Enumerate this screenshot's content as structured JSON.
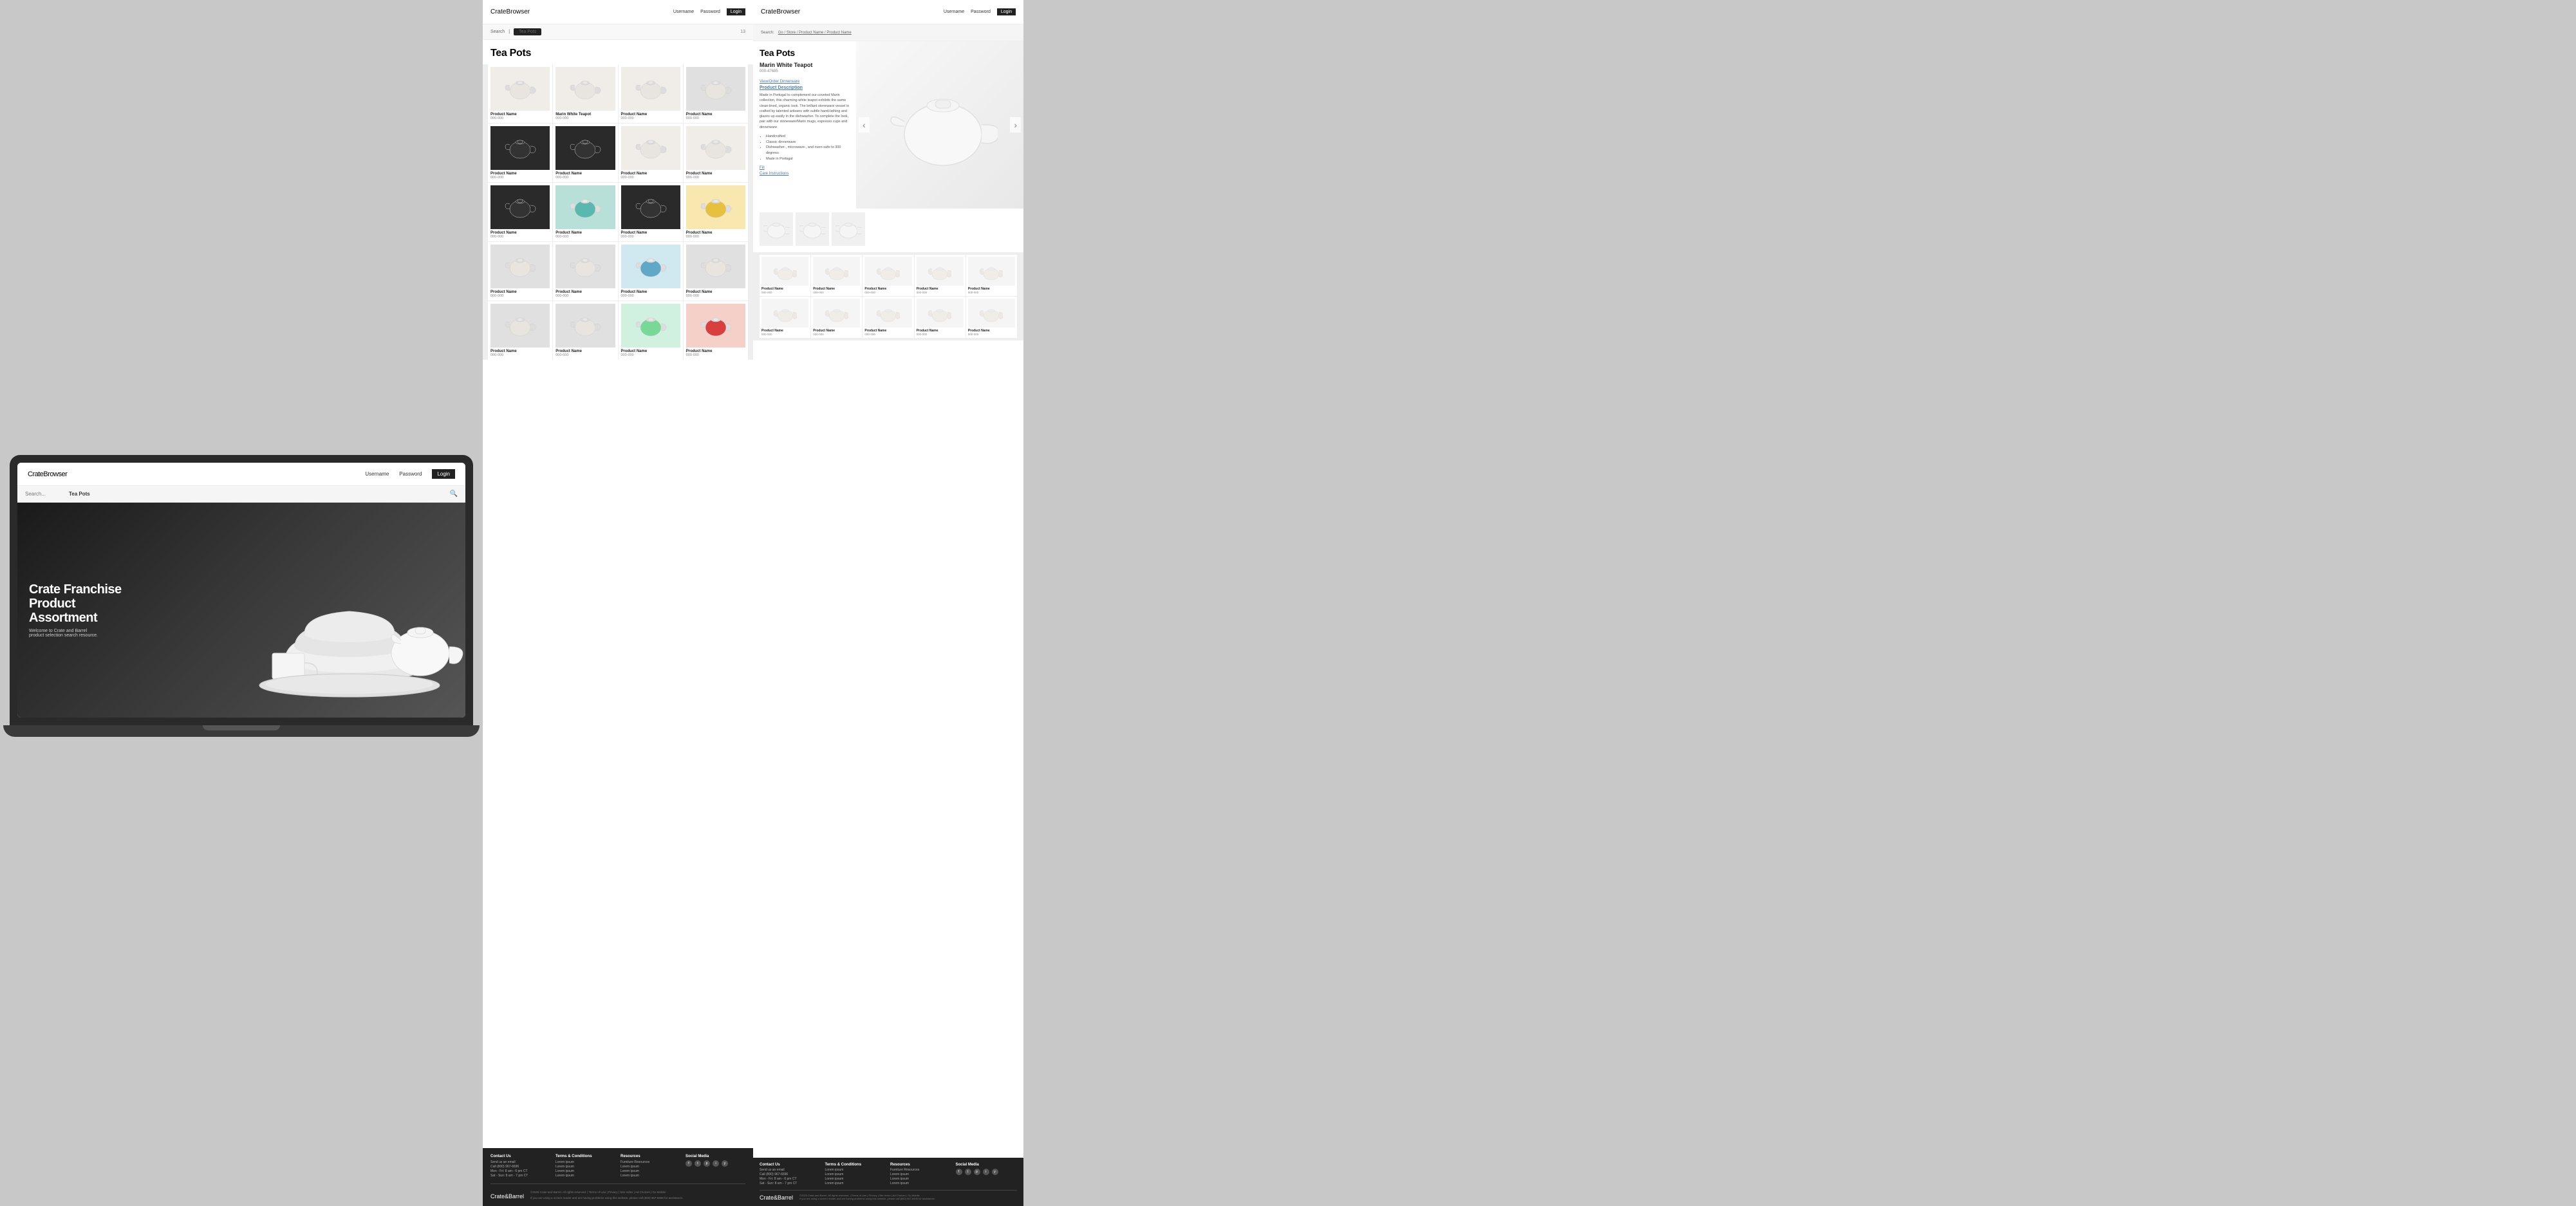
{
  "laptop": {
    "logo": "Crate",
    "logo_suffix": "Browser",
    "nav": {
      "username": "Username",
      "password": "Password",
      "login": "Login"
    },
    "search": {
      "placeholder": "Search...",
      "term": "Tea Pots"
    },
    "hero": {
      "headline_line1": "Crate Franchise",
      "headline_line2": "Product",
      "headline_line3": "Assortment",
      "subtext_line1": "Welcome to Crate and Barrel",
      "subtext_line2": "product selection search resource."
    }
  },
  "product_grid": {
    "logo": "Crate",
    "logo_suffix": "Browser",
    "nav": {
      "username": "Username",
      "password": "Password",
      "login": "Login"
    },
    "breadcrumb": {
      "search": "Search",
      "tab": "Tea Pots",
      "count": "13"
    },
    "title": "Tea Pots",
    "products": [
      {
        "name": "Product Name",
        "sku": "000-000",
        "style": "kettle-white"
      },
      {
        "name": "Marin White Teapot",
        "sku": "000-000",
        "style": "kettle-white"
      },
      {
        "name": "Product Name",
        "sku": "000-000",
        "style": "kettle-white"
      },
      {
        "name": "Product Name",
        "sku": "000-000",
        "style": "kettle-silver"
      },
      {
        "name": "Product Name",
        "sku": "000-000",
        "style": "kettle-black"
      },
      {
        "name": "Product Name",
        "sku": "000-000",
        "style": "kettle-black"
      },
      {
        "name": "Product Name",
        "sku": "000-000",
        "style": "kettle-white"
      },
      {
        "name": "Product Name",
        "sku": "000-000",
        "style": "kettle-white"
      },
      {
        "name": "Product Name",
        "sku": "000-000",
        "style": "kettle-black"
      },
      {
        "name": "Product Name",
        "sku": "000-000",
        "style": "kettle-teal"
      },
      {
        "name": "Product Name",
        "sku": "000-000",
        "style": "kettle-black"
      },
      {
        "name": "Product Name",
        "sku": "000-000",
        "style": "kettle-yellow"
      },
      {
        "name": "Product Name",
        "sku": "000-000",
        "style": "kettle-silver"
      },
      {
        "name": "Product Name",
        "sku": "000-000",
        "style": "kettle-silver"
      },
      {
        "name": "Product Name",
        "sku": "000-000",
        "style": "kettle-blue"
      },
      {
        "name": "Product Name",
        "sku": "000-000",
        "style": "kettle-silver"
      },
      {
        "name": "Product Name",
        "sku": "000-000",
        "style": "kettle-silver"
      },
      {
        "name": "Product Name",
        "sku": "000-000",
        "style": "kettle-silver"
      },
      {
        "name": "Product Name",
        "sku": "000-000",
        "style": "kettle-mint"
      },
      {
        "name": "Product Name",
        "sku": "000-000",
        "style": "kettle-red"
      }
    ],
    "footer": {
      "contact": {
        "title": "Contact Us",
        "line1": "Send us an email",
        "line2": "Call (800) 967-6696",
        "line3": "Mon - Fri: 8 am - 6 pm CT",
        "line4": "Sat - Sun: 8 am - 7 pm CT"
      },
      "terms": {
        "title": "Terms & Conditions",
        "line1": "Lorem ipsum",
        "line2": "Lorem ipsum",
        "line3": "Lorem ipsum",
        "line4": "Lorem ipsum"
      },
      "resources": {
        "title": "Resources",
        "line1": "Furniture Resources",
        "line2": "Lorem ipsum",
        "line3": "Lorem ipsum",
        "line4": "Lorem ipsum"
      },
      "social": {
        "title": "Social Media"
      },
      "logo": "Crate",
      "logo_suffix": "&Barrel",
      "legal": "©2025 Crate and Barrel. All rights reserved. | Terms of Use | Privacy | Site Index | Ad Choices | Go Mobile",
      "accessibility": "If you are using a screen reader and are having problems using this website, please call (800) 967-6696 for assistance."
    }
  },
  "product_detail": {
    "logo": "Crate",
    "logo_suffix": "Browser",
    "nav": {
      "username": "Username",
      "password": "Password",
      "login": "Login"
    },
    "search_bar": {
      "prefix": "Search:",
      "path": "Go / Store / Product Name / Product Name"
    },
    "page_title": "Tea Pots",
    "product": {
      "name": "Marin White Teapot",
      "sku": "000-47685",
      "department": "View/Order Dinnerware"
    },
    "description_title": "Product Description",
    "description": "Made in Portugal to complement our coveted Marin collection, this charming white teapot exhibits the same clean-lined, organic look. The brillant stoneware vessel is crafted by talented artisans with subtle hand-lathing and glazes up easily in the dishwasher. To complete the look, pair with our stoneware/Marin mugs, espresso cups and dinnerware.",
    "bullets": [
      "Handcrafted",
      "Classic dinnerware",
      "Dishwasher-, microwave-, and oven-safe to 300 degrees",
      "Made in Portugal"
    ],
    "fill_label": "Fill",
    "care_label": "Care Instructions",
    "thumbnails": [
      {
        "style": "white-teapot"
      },
      {
        "style": "white-teapot"
      },
      {
        "style": "white-teapot"
      }
    ],
    "related_products": [
      {
        "name": "Product Name",
        "sku": "000-000",
        "style": "kettle-white"
      },
      {
        "name": "Product Name",
        "sku": "000-000",
        "style": "kettle-white"
      },
      {
        "name": "Product Name",
        "sku": "000-000",
        "style": "kettle-white"
      },
      {
        "name": "Product Name",
        "sku": "000-000",
        "style": "kettle-white"
      },
      {
        "name": "Product Name",
        "sku": "000-000",
        "style": "kettle-white"
      },
      {
        "name": "Product Name",
        "sku": "000-000",
        "style": "kettle-white"
      },
      {
        "name": "Product Name",
        "sku": "000-000",
        "style": "kettle-white"
      },
      {
        "name": "Product Name",
        "sku": "000-000",
        "style": "kettle-white"
      },
      {
        "name": "Product Name",
        "sku": "000-000",
        "style": "kettle-white"
      },
      {
        "name": "Product Name",
        "sku": "000-000",
        "style": "kettle-white"
      }
    ],
    "footer": {
      "contact": {
        "title": "Contact Us",
        "line1": "Send us an email",
        "line2": "Call (800) 967-6696",
        "line3": "Mon - Fri: 8 am - 6 pm CT",
        "line4": "Sat - Sun: 8 am - 7 pm CT"
      },
      "terms": {
        "title": "Terms & Conditions",
        "line1": "Lorem ipsum",
        "line2": "Lorem ipsum",
        "line3": "Lorem ipsum",
        "line4": "Lorem ipsum"
      },
      "resources": {
        "title": "Resources",
        "line1": "Furniture Resources",
        "line2": "Lorem ipsum",
        "line3": "Lorem ipsum",
        "line4": "Lorem ipsum"
      },
      "social": {
        "title": "Social Media"
      },
      "logo": "Crate",
      "logo_suffix": "&Barrel",
      "legal": "©2025 Crate and Barrel. All rights reserved. | Terms of Use | Privacy | Site Index | Ad Choices | Go Mobile",
      "accessibility": "If you are using a screen reader and are having problems using this website, please call (800) 967-6696 for assistance."
    }
  }
}
